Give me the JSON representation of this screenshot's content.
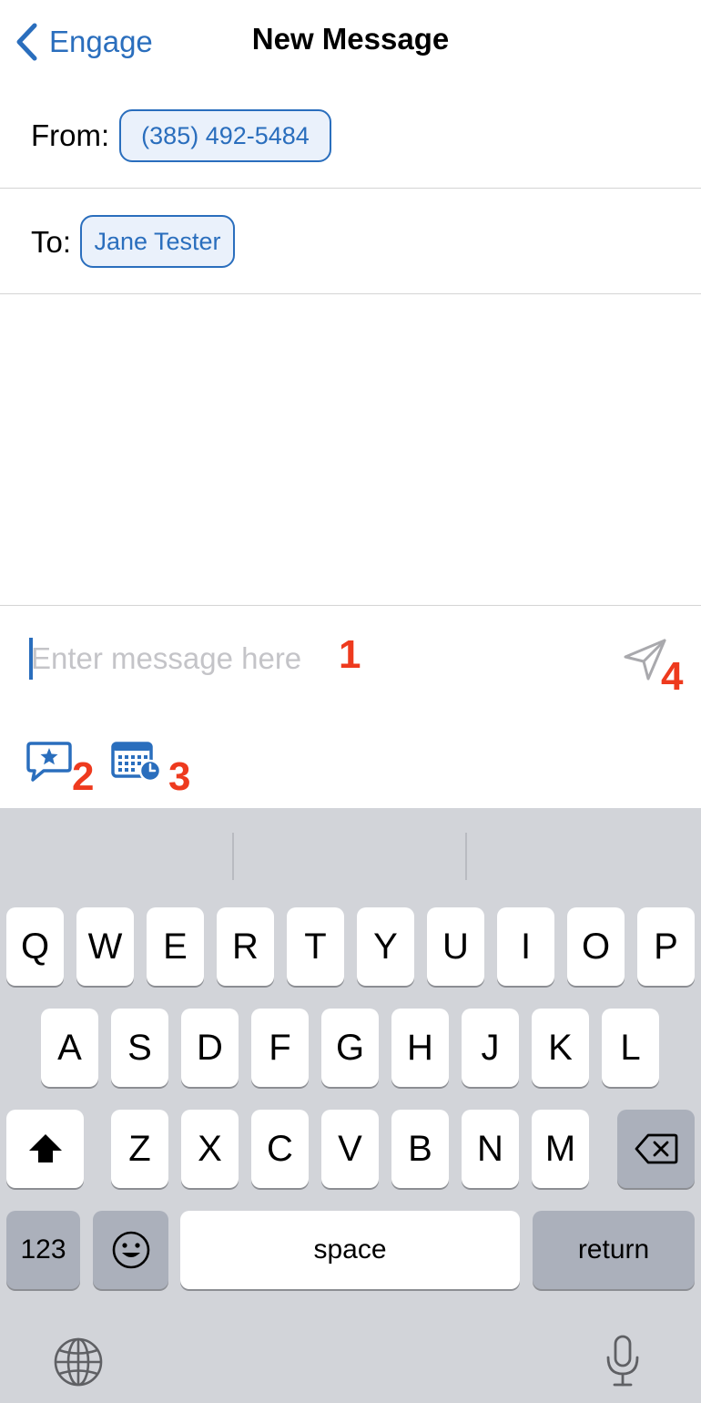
{
  "nav": {
    "back_label": "Engage",
    "title": "New Message"
  },
  "from": {
    "label": "From:",
    "value": "(385) 492-5484"
  },
  "to": {
    "label": "To:",
    "recipient": "Jane Tester"
  },
  "compose": {
    "placeholder": "Enter message here",
    "value": ""
  },
  "annotations": {
    "a1": "1",
    "a2": "2",
    "a3": "3",
    "a4": "4"
  },
  "colors": {
    "accent": "#2a6ebd",
    "annotation": "#ee3a1e",
    "keyboard_bg": "#d2d4d9"
  },
  "toolbar": {
    "icons": [
      "favorite-message-icon",
      "schedule-calendar-icon"
    ]
  },
  "keyboard": {
    "row1": [
      "Q",
      "W",
      "E",
      "R",
      "T",
      "Y",
      "U",
      "I",
      "O",
      "P"
    ],
    "row2": [
      "A",
      "S",
      "D",
      "F",
      "G",
      "H",
      "J",
      "K",
      "L"
    ],
    "row3": [
      "Z",
      "X",
      "C",
      "V",
      "B",
      "N",
      "M"
    ],
    "numbers_label": "123",
    "space_label": "space",
    "return_label": "return"
  }
}
